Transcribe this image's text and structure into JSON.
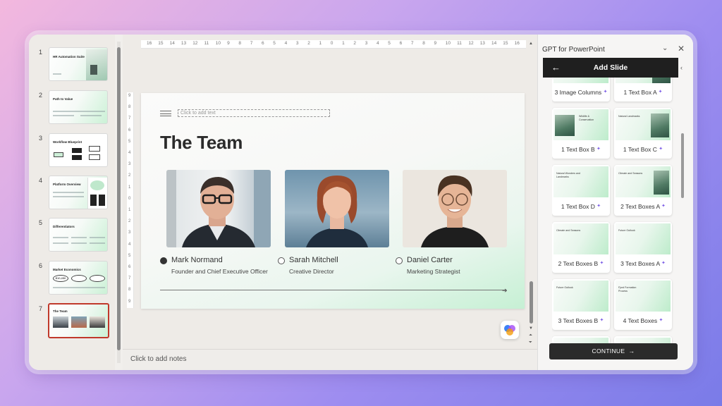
{
  "thumbnails": [
    {
      "num": "1",
      "title": "HR Automation Suite"
    },
    {
      "num": "2",
      "title": "Path to Value"
    },
    {
      "num": "3",
      "title": "Workflow Blueprint"
    },
    {
      "num": "4",
      "title": "Platform Overview"
    },
    {
      "num": "5",
      "title": "Differentiators"
    },
    {
      "num": "6",
      "title": "Market Economics",
      "stat": "$10,450"
    },
    {
      "num": "7",
      "title": "The Team"
    }
  ],
  "ruler": {
    "h": [
      "16",
      "15",
      "14",
      "13",
      "12",
      "11",
      "10",
      "9",
      "8",
      "7",
      "6",
      "5",
      "4",
      "3",
      "2",
      "1",
      "0",
      "1",
      "2",
      "3",
      "4",
      "5",
      "6",
      "7",
      "8",
      "9",
      "10",
      "11",
      "12",
      "13",
      "14",
      "15",
      "16"
    ],
    "v": [
      "9",
      "8",
      "7",
      "6",
      "5",
      "4",
      "3",
      "2",
      "1",
      "0",
      "1",
      "2",
      "3",
      "4",
      "5",
      "6",
      "7",
      "8",
      "9"
    ]
  },
  "slide": {
    "placeholder": "Click to add text",
    "title": "The Team",
    "members": [
      {
        "name": "Mark Normand",
        "role": "Founder and Chief Executive Officer",
        "selected": true
      },
      {
        "name": "Sarah Mitchell",
        "role": "Creative Director",
        "selected": false
      },
      {
        "name": "Daniel Carter",
        "role": "Marketing Strategist",
        "selected": false
      }
    ]
  },
  "notes": {
    "placeholder": "Click to add notes"
  },
  "panel": {
    "title": "GPT for PowerPoint",
    "subtitle": "Add Slide",
    "cards": [
      {
        "label": "3 Image Columns",
        "thumb_title": ""
      },
      {
        "label": "1 Text Box A",
        "thumb_title": ""
      },
      {
        "label": "1 Text Box B",
        "thumb_title": "Wildlife & Conservation"
      },
      {
        "label": "1 Text Box C",
        "thumb_title": "Natural Landmarks"
      },
      {
        "label": "1 Text Box D",
        "thumb_title": "Natural Wonders and Landmarks"
      },
      {
        "label": "2 Text Boxes A",
        "thumb_title": "Climate and Seasons"
      },
      {
        "label": "2 Text Boxes B",
        "thumb_title": "Climate and Seasons"
      },
      {
        "label": "3 Text Boxes A",
        "thumb_title": "Future Outlook"
      },
      {
        "label": "3 Text Boxes B",
        "thumb_title": "Future Outlook"
      },
      {
        "label": "4 Text Boxes",
        "thumb_title": "Fjord Formation Process"
      }
    ],
    "continue_label": "CONTINUE"
  },
  "colors": {
    "accent": "#7b5ce6",
    "selection": "#c0392b",
    "slide_green": "#c6f0d4"
  },
  "icons": {
    "sparkle": "✦",
    "back": "arrow-left-icon",
    "close": "close-icon",
    "chevron": "chevron-down-icon",
    "continue": "arrow-right-icon"
  }
}
